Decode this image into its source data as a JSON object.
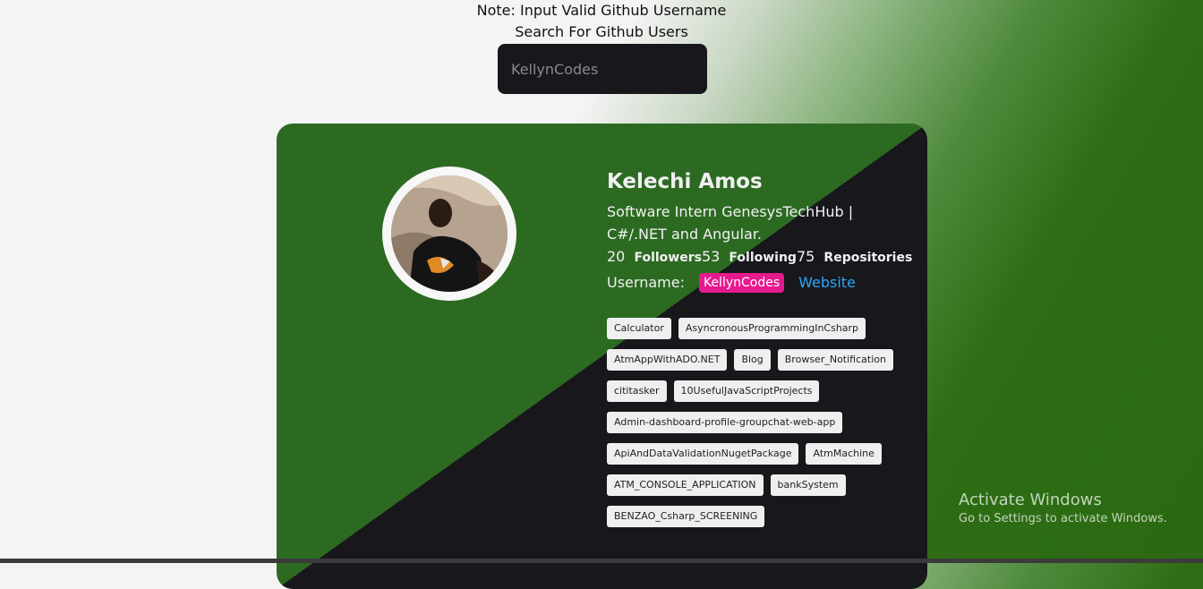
{
  "header": {
    "note": "Note: Input Valid Github Username",
    "subtitle": "Search For Github Users"
  },
  "search": {
    "placeholder": "KellynCodes"
  },
  "profile": {
    "name": "Kelechi Amos",
    "bio_line1": "Software Intern GenesysTechHub |",
    "bio_line2": "C#/.NET and Angular.",
    "followers_count": "20",
    "followers_label": "Followers",
    "following_count": "53",
    "following_label": "Following",
    "repos_count": "75",
    "repos_label": "Repositories",
    "username_label": "Username:",
    "username": "KellynCodes",
    "website_label": "Website"
  },
  "repos": [
    "Calculator",
    "AsyncronousProgrammingInCsharp",
    "AtmAppWithADO.NET",
    "Blog",
    "Browser_Notification",
    "cititasker",
    "10UsefulJavaScriptProjects",
    "Admin-dashboard-profile-groupchat-web-app",
    "ApiAndDataValidationNugetPackage",
    "AtmMachine",
    "ATM_CONSOLE_APPLICATION",
    "bankSystem",
    "BENZAO_Csharp_SCREENING"
  ],
  "watermark": {
    "title": "Activate Windows",
    "subtitle": "Go to Settings to activate Windows."
  },
  "colors": {
    "card_green": "#2c6a22",
    "card_dark": "#18171c",
    "username_pill": "#e6198e",
    "website_link": "#2aa8ff"
  }
}
